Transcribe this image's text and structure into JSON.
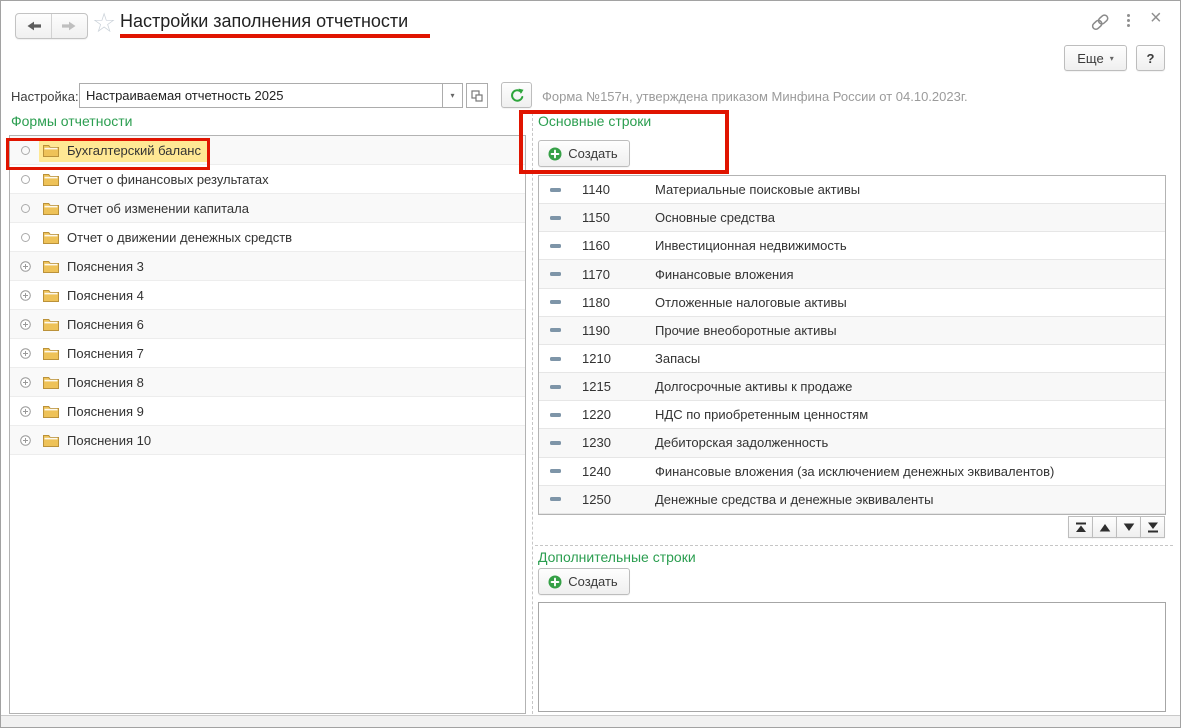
{
  "window": {
    "title": "Настройки заполнения отчетности",
    "more_button": "Еще",
    "more_caret": "▾",
    "help_button": "?"
  },
  "toolbar": {
    "setting_label": "Настройка:",
    "setting_value": "Настраиваемая отчетность 2025",
    "dropdown_caret": "▾",
    "form_info": "Форма №157н, утверждена приказом Минфина России от 04.10.2023г."
  },
  "forms_panel": {
    "header": "Формы отчетности",
    "items": [
      {
        "label": "Бухгалтерский баланс",
        "expander": "circle",
        "selected": true
      },
      {
        "label": "Отчет о финансовых результатах",
        "expander": "circle",
        "selected": false
      },
      {
        "label": "Отчет об изменении капитала",
        "expander": "circle",
        "selected": false
      },
      {
        "label": "Отчет о движении денежных средств",
        "expander": "circle",
        "selected": false
      },
      {
        "label": "Пояснения 3",
        "expander": "plus",
        "selected": false
      },
      {
        "label": "Пояснения 4",
        "expander": "plus",
        "selected": false
      },
      {
        "label": "Пояснения 6",
        "expander": "plus",
        "selected": false
      },
      {
        "label": "Пояснения 7",
        "expander": "plus",
        "selected": false
      },
      {
        "label": "Пояснения 8",
        "expander": "plus",
        "selected": false
      },
      {
        "label": "Пояснения 9",
        "expander": "plus",
        "selected": false
      },
      {
        "label": "Пояснения 10",
        "expander": "plus",
        "selected": false
      }
    ]
  },
  "main_rows_panel": {
    "header": "Основные строки",
    "create_button": "Создать",
    "rows": [
      {
        "code": "1140",
        "name": "Материальные поисковые активы"
      },
      {
        "code": "1150",
        "name": "Основные средства"
      },
      {
        "code": "1160",
        "name": "Инвестиционная недвижимость"
      },
      {
        "code": "1170",
        "name": "Финансовые вложения"
      },
      {
        "code": "1180",
        "name": "Отложенные налоговые активы"
      },
      {
        "code": "1190",
        "name": "Прочие внеоборотные активы"
      },
      {
        "code": "1210",
        "name": "Запасы"
      },
      {
        "code": "1215",
        "name": "Долгосрочные активы к продаже"
      },
      {
        "code": "1220",
        "name": "НДС по приобретенным ценностям"
      },
      {
        "code": "1230",
        "name": "Дебиторская задолженность"
      },
      {
        "code": "1240",
        "name": "Финансовые вложения (за исключением денежных эквивалентов)"
      },
      {
        "code": "1250",
        "name": "Денежные средства и денежные эквиваленты"
      }
    ]
  },
  "additional_rows_panel": {
    "header": "Дополнительные строки",
    "create_button": "Создать"
  },
  "colors": {
    "group_header_green": "#2b9e50",
    "selection_yellow": "#ffe894",
    "annotation_red": "#e01400",
    "create_plus_green": "#35a046",
    "refresh_green": "#2ea53c",
    "row_dash_blue": "#7e95a8",
    "folder_yellow": "#eec258"
  }
}
